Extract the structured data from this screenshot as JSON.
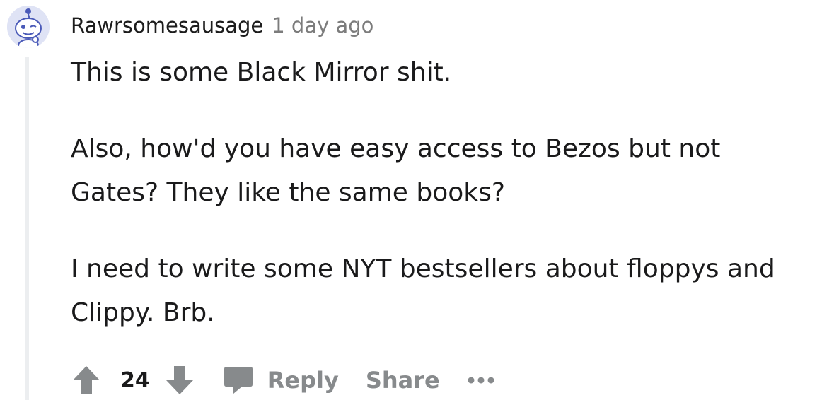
{
  "comment": {
    "author": "Rawrsomesausage",
    "timestamp": "1 day ago",
    "paragraphs": [
      "This is some Black Mirror shit.",
      "Also, how'd you have easy access to Bezos but not Gates? They like the same books?",
      "I need to write some NYT bestsellers about floppys and Clippy. Brb."
    ]
  },
  "actions": {
    "score": "24",
    "reply_label": "Reply",
    "share_label": "Share"
  },
  "icons": {
    "avatar": "snoo-avatar",
    "upvote": "arrow-up-icon",
    "downvote": "arrow-down-icon",
    "reply": "speech-bubble-icon",
    "more": "ellipsis-icon"
  },
  "colors": {
    "icon_gray": "#878a8c",
    "thread_line": "#eceef0",
    "avatar_bg": "#dfe3f5",
    "text": "#1a1a1b",
    "meta_text": "#7c7c7c"
  }
}
